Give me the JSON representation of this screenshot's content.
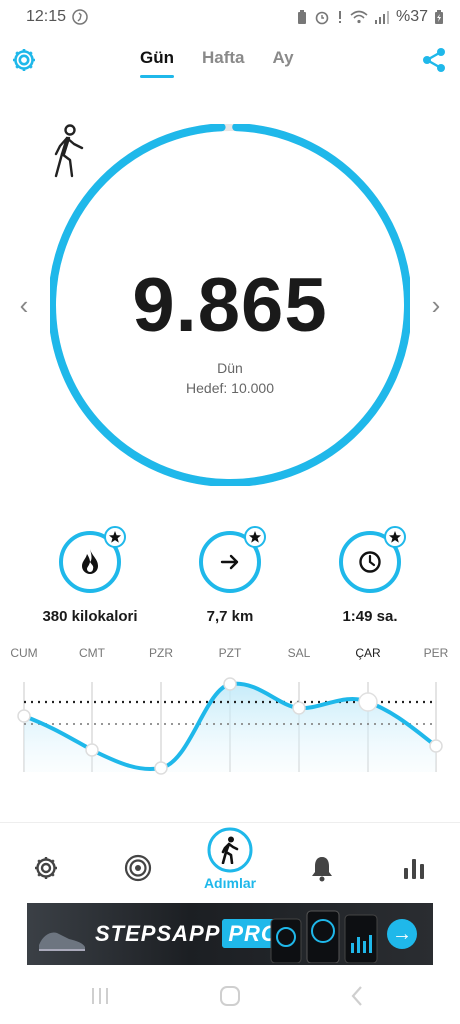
{
  "status_bar": {
    "time": "12:15",
    "battery": "%37"
  },
  "tabs": [
    {
      "label": "Gün",
      "active": true
    },
    {
      "label": "Hafta",
      "active": false
    },
    {
      "label": "Ay",
      "active": false
    }
  ],
  "summary": {
    "steps": "9.865",
    "day_label": "Dün",
    "goal_text": "Hedef: 10.000",
    "progress_fraction": 0.9865
  },
  "stats": [
    {
      "icon": "flame-icon",
      "label": "380 kilokalori"
    },
    {
      "icon": "arrow-right-icon",
      "label": "7,7 km"
    },
    {
      "icon": "clock-icon",
      "label": "1:49 sa."
    }
  ],
  "week": {
    "days": [
      "CUM",
      "CMT",
      "PZR",
      "PZT",
      "SAL",
      "ÇAR",
      "PER"
    ],
    "current_day": "ÇAR"
  },
  "bottom_nav": {
    "items": [
      {
        "icon": "gear-icon"
      },
      {
        "icon": "target-icon"
      },
      {
        "icon": "walker-icon",
        "label": "Adımlar",
        "active": true
      },
      {
        "icon": "bell-icon"
      },
      {
        "icon": "bar-chart-icon"
      }
    ]
  },
  "ad": {
    "brand_main": "STEPSAPP",
    "brand_suffix": "PRO"
  },
  "colors": {
    "accent": "#1fb8ea",
    "text": "#1a1a1a"
  }
}
